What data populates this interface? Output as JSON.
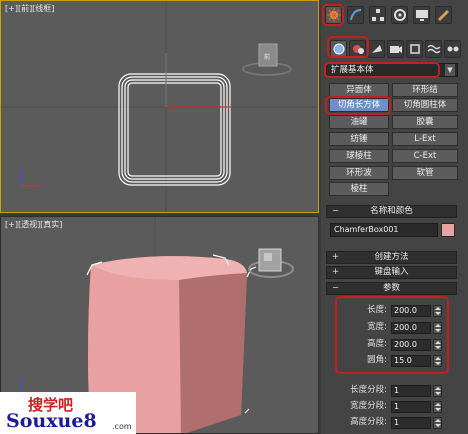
{
  "viewport_top": {
    "label": "[+][前][线框]",
    "gizmo_label": "前"
  },
  "viewport_persp": {
    "label": "[+][透视][真实]"
  },
  "command_panel": {
    "tabs": [
      "create-tab",
      "modify-tab",
      "hierarchy-tab",
      "motion-tab",
      "display-tab",
      "utilities-tab"
    ],
    "category_icons": [
      "geometry-icon",
      "shapes-icon",
      "lights-icon",
      "cameras-icon",
      "helpers-icon",
      "spacewarps-icon",
      "systems-icon"
    ],
    "dropdown_value": "扩展基本体",
    "object_types": [
      "异面体",
      "环形结",
      "切角长方体",
      "切角圆柱体",
      "油罐",
      "胶囊",
      "纺锤",
      "L-Ext",
      "球棱柱",
      "C-Ext",
      "环形波",
      "软管",
      "棱柱"
    ],
    "active_object_type": "切角长方体",
    "name_color_header": "名称和颜色",
    "object_name": "ChamferBox001",
    "object_color": "#e5a3a3",
    "rollouts": {
      "creation_method": "创建方法",
      "keyboard_entry": "键盘输入",
      "parameters": "参数"
    },
    "params": [
      {
        "label": "长度:",
        "value": "200.0"
      },
      {
        "label": "宽度:",
        "value": "200.0"
      },
      {
        "label": "高度:",
        "value": "200.0"
      },
      {
        "label": "圆角:",
        "value": "15.0"
      }
    ],
    "segments": [
      {
        "label": "长度分段:",
        "value": "1"
      },
      {
        "label": "宽度分段:",
        "value": "1"
      },
      {
        "label": "高度分段:",
        "value": "1"
      }
    ]
  },
  "watermark": {
    "line1": "搜学吧",
    "line2": "Souxue8",
    "line3": ".com"
  },
  "colors": {
    "accent_red": "#c81e1e",
    "active_blue": "#6c91c9",
    "box_pink": "#e8a0a0",
    "viewport_gray": "#5b5b5b"
  }
}
